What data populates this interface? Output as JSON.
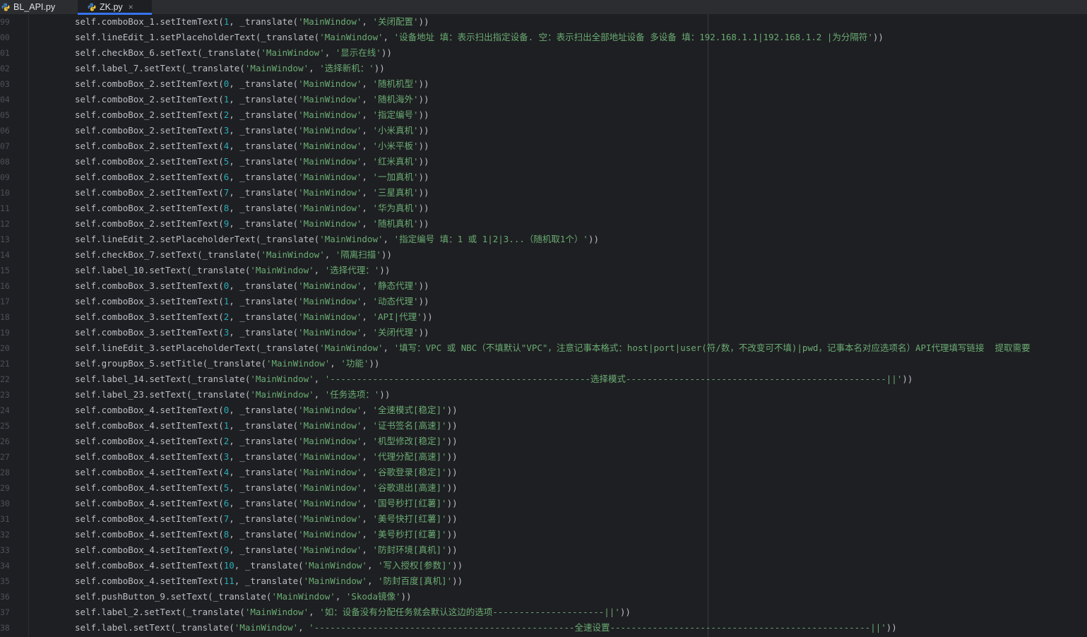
{
  "tabs": [
    {
      "label": "BL_API.py",
      "active": false
    },
    {
      "label": "ZK.py",
      "active": true
    }
  ],
  "close_glyph": "×",
  "colors": {
    "background": "#1e1f22",
    "tab_bar": "#2b2d30",
    "active_tab_underline": "#3574f0",
    "plain_text": "#bcbec4",
    "number": "#2aacb8",
    "string": "#6aab73",
    "line_number": "#4b5059"
  },
  "lines": [
    {
      "num": "99",
      "pre": "self.comboBox_1.setItemText(",
      "idx": "1",
      "mid": ", _translate(",
      "win": "'MainWindow'",
      "sep": ", ",
      "text": "'关闭配置'",
      "post": "))"
    },
    {
      "num": "00",
      "pre": "self.lineEdit_1.setPlaceholderText(_translate(",
      "idx": "",
      "mid": "",
      "win": "'MainWindow'",
      "sep": ", ",
      "text": "'设备地址 填：表示扫出指定设备. 空：表示扫出全部地址设备 多设备 填：192.168.1.1|192.168.1.2 |为分隔符'",
      "post": "))"
    },
    {
      "num": "01",
      "pre": "self.checkBox_6.setText(_translate(",
      "idx": "",
      "mid": "",
      "win": "'MainWindow'",
      "sep": ", ",
      "text": "'显示在线'",
      "post": "))"
    },
    {
      "num": "02",
      "pre": "self.label_7.setText(_translate(",
      "idx": "",
      "mid": "",
      "win": "'MainWindow'",
      "sep": ", ",
      "text": "'选择新机：'",
      "post": "))"
    },
    {
      "num": "03",
      "pre": "self.comboBox_2.setItemText(",
      "idx": "0",
      "mid": ", _translate(",
      "win": "'MainWindow'",
      "sep": ", ",
      "text": "'随机机型'",
      "post": "))"
    },
    {
      "num": "04",
      "pre": "self.comboBox_2.setItemText(",
      "idx": "1",
      "mid": ", _translate(",
      "win": "'MainWindow'",
      "sep": ", ",
      "text": "'随机海外'",
      "post": "))"
    },
    {
      "num": "05",
      "pre": "self.comboBox_2.setItemText(",
      "idx": "2",
      "mid": ", _translate(",
      "win": "'MainWindow'",
      "sep": ", ",
      "text": "'指定编号'",
      "post": "))"
    },
    {
      "num": "06",
      "pre": "self.comboBox_2.setItemText(",
      "idx": "3",
      "mid": ", _translate(",
      "win": "'MainWindow'",
      "sep": ", ",
      "text": "'小米真机'",
      "post": "))"
    },
    {
      "num": "07",
      "pre": "self.comboBox_2.setItemText(",
      "idx": "4",
      "mid": ", _translate(",
      "win": "'MainWindow'",
      "sep": ", ",
      "text": "'小米平板'",
      "post": "))"
    },
    {
      "num": "08",
      "pre": "self.comboBox_2.setItemText(",
      "idx": "5",
      "mid": ", _translate(",
      "win": "'MainWindow'",
      "sep": ", ",
      "text": "'红米真机'",
      "post": "))"
    },
    {
      "num": "09",
      "pre": "self.comboBox_2.setItemText(",
      "idx": "6",
      "mid": ", _translate(",
      "win": "'MainWindow'",
      "sep": ", ",
      "text": "'一加真机'",
      "post": "))"
    },
    {
      "num": "10",
      "pre": "self.comboBox_2.setItemText(",
      "idx": "7",
      "mid": ", _translate(",
      "win": "'MainWindow'",
      "sep": ", ",
      "text": "'三星真机'",
      "post": "))"
    },
    {
      "num": "11",
      "pre": "self.comboBox_2.setItemText(",
      "idx": "8",
      "mid": ", _translate(",
      "win": "'MainWindow'",
      "sep": ", ",
      "text": "'华为真机'",
      "post": "))"
    },
    {
      "num": "12",
      "pre": "self.comboBox_2.setItemText(",
      "idx": "9",
      "mid": ", _translate(",
      "win": "'MainWindow'",
      "sep": ", ",
      "text": "'随机真机'",
      "post": "))"
    },
    {
      "num": "13",
      "pre": "self.lineEdit_2.setPlaceholderText(_translate(",
      "idx": "",
      "mid": "",
      "win": "'MainWindow'",
      "sep": ", ",
      "text": "'指定编号 填：1 或 1|2|3...（随机取1个）'",
      "post": "))"
    },
    {
      "num": "14",
      "pre": "self.checkBox_7.setText(_translate(",
      "idx": "",
      "mid": "",
      "win": "'MainWindow'",
      "sep": ", ",
      "text": "'隔离扫描'",
      "post": "))"
    },
    {
      "num": "15",
      "pre": "self.label_10.setText(_translate(",
      "idx": "",
      "mid": "",
      "win": "'MainWindow'",
      "sep": ", ",
      "text": "'选择代理：'",
      "post": "))"
    },
    {
      "num": "16",
      "pre": "self.comboBox_3.setItemText(",
      "idx": "0",
      "mid": ", _translate(",
      "win": "'MainWindow'",
      "sep": ", ",
      "text": "'静态代理'",
      "post": "))"
    },
    {
      "num": "17",
      "pre": "self.comboBox_3.setItemText(",
      "idx": "1",
      "mid": ", _translate(",
      "win": "'MainWindow'",
      "sep": ", ",
      "text": "'动态代理'",
      "post": "))"
    },
    {
      "num": "18",
      "pre": "self.comboBox_3.setItemText(",
      "idx": "2",
      "mid": ", _translate(",
      "win": "'MainWindow'",
      "sep": ", ",
      "text": "'API|代理'",
      "post": "))"
    },
    {
      "num": "19",
      "pre": "self.comboBox_3.setItemText(",
      "idx": "3",
      "mid": ", _translate(",
      "win": "'MainWindow'",
      "sep": ", ",
      "text": "'关闭代理'",
      "post": "))"
    },
    {
      "num": "20",
      "pre": "self.lineEdit_3.setPlaceholderText(_translate(",
      "idx": "",
      "mid": "",
      "win": "'MainWindow'",
      "sep": ", ",
      "text": "'填写：VPC 或 NBC（不填默认\"VPC\"，注意记事本格式：host|port|user(符/数，不改变可不填)|pwd，记事本名对应选项名）API代理填写链接  提取需要",
      "post": ""
    },
    {
      "num": "21",
      "pre": "self.groupBox_5.setTitle(_translate(",
      "idx": "",
      "mid": "",
      "win": "'MainWindow'",
      "sep": ", ",
      "text": "'功能'",
      "post": "))"
    },
    {
      "num": "22",
      "pre": "self.label_14.setText(_translate(",
      "idx": "",
      "mid": "",
      "win": "'MainWindow'",
      "sep": ", ",
      "text": "'-------------------------------------------------选择模式-------------------------------------------------||'",
      "post": "))"
    },
    {
      "num": "23",
      "pre": "self.label_23.setText(_translate(",
      "idx": "",
      "mid": "",
      "win": "'MainWindow'",
      "sep": ", ",
      "text": "'任务选项：'",
      "post": "))"
    },
    {
      "num": "24",
      "pre": "self.comboBox_4.setItemText(",
      "idx": "0",
      "mid": ", _translate(",
      "win": "'MainWindow'",
      "sep": ", ",
      "text": "'全速模式[稳定]'",
      "post": "))"
    },
    {
      "num": "25",
      "pre": "self.comboBox_4.setItemText(",
      "idx": "1",
      "mid": ", _translate(",
      "win": "'MainWindow'",
      "sep": ", ",
      "text": "'证书签名[高速]'",
      "post": "))"
    },
    {
      "num": "26",
      "pre": "self.comboBox_4.setItemText(",
      "idx": "2",
      "mid": ", _translate(",
      "win": "'MainWindow'",
      "sep": ", ",
      "text": "'机型修改[稳定]'",
      "post": "))"
    },
    {
      "num": "27",
      "pre": "self.comboBox_4.setItemText(",
      "idx": "3",
      "mid": ", _translate(",
      "win": "'MainWindow'",
      "sep": ", ",
      "text": "'代理分配[高速]'",
      "post": "))"
    },
    {
      "num": "28",
      "pre": "self.comboBox_4.setItemText(",
      "idx": "4",
      "mid": ", _translate(",
      "win": "'MainWindow'",
      "sep": ", ",
      "text": "'谷歌登录[稳定]'",
      "post": "))"
    },
    {
      "num": "29",
      "pre": "self.comboBox_4.setItemText(",
      "idx": "5",
      "mid": ", _translate(",
      "win": "'MainWindow'",
      "sep": ", ",
      "text": "'谷歌退出[高速]'",
      "post": "))"
    },
    {
      "num": "30",
      "pre": "self.comboBox_4.setItemText(",
      "idx": "6",
      "mid": ", _translate(",
      "win": "'MainWindow'",
      "sep": ", ",
      "text": "'国号秒打[红薯]'",
      "post": "))"
    },
    {
      "num": "31",
      "pre": "self.comboBox_4.setItemText(",
      "idx": "7",
      "mid": ", _translate(",
      "win": "'MainWindow'",
      "sep": ", ",
      "text": "'美号快打[红薯]'",
      "post": "))"
    },
    {
      "num": "32",
      "pre": "self.comboBox_4.setItemText(",
      "idx": "8",
      "mid": ", _translate(",
      "win": "'MainWindow'",
      "sep": ", ",
      "text": "'美号秒打[红薯]'",
      "post": "))"
    },
    {
      "num": "33",
      "pre": "self.comboBox_4.setItemText(",
      "idx": "9",
      "mid": ", _translate(",
      "win": "'MainWindow'",
      "sep": ", ",
      "text": "'防封环境[真机]'",
      "post": "))"
    },
    {
      "num": "34",
      "pre": "self.comboBox_4.setItemText(",
      "idx": "10",
      "mid": ", _translate(",
      "win": "'MainWindow'",
      "sep": ", ",
      "text": "'写入授权[参数]'",
      "post": "))"
    },
    {
      "num": "35",
      "pre": "self.comboBox_4.setItemText(",
      "idx": "11",
      "mid": ", _translate(",
      "win": "'MainWindow'",
      "sep": ", ",
      "text": "'防封百度[真机]'",
      "post": "))"
    },
    {
      "num": "36",
      "pre": "self.pushButton_9.setText(_translate(",
      "idx": "",
      "mid": "",
      "win": "'MainWindow'",
      "sep": ", ",
      "text": "'Skoda镜像'",
      "post": "))"
    },
    {
      "num": "37",
      "pre": "self.label_2.setText(_translate(",
      "idx": "",
      "mid": "",
      "win": "'MainWindow'",
      "sep": ", ",
      "text": "'如：设备没有分配任务就会默认这边的选项---------------------||'",
      "post": "))"
    },
    {
      "num": "38",
      "pre": "self.label.setText(_translate(",
      "idx": "",
      "mid": "",
      "win": "'MainWindow'",
      "sep": ", ",
      "text": "'-------------------------------------------------全速设置-------------------------------------------------||'",
      "post": "))"
    }
  ]
}
